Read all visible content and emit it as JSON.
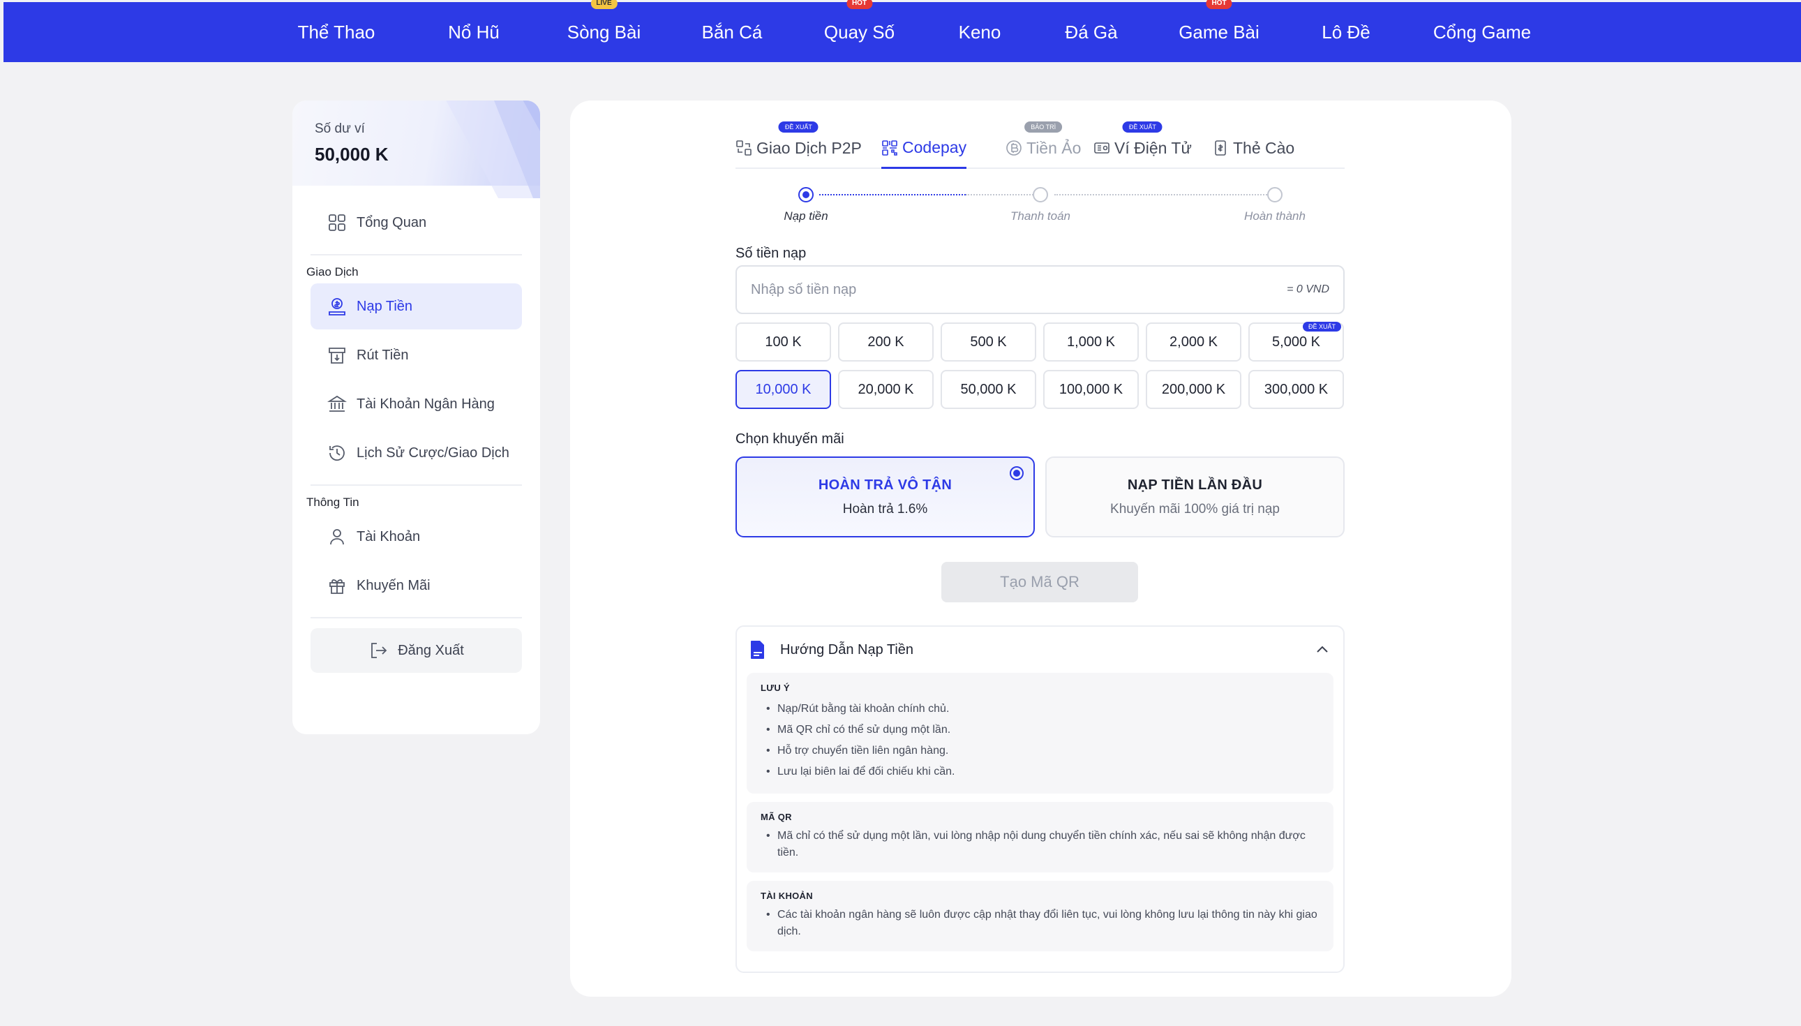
{
  "topnav": {
    "items": [
      {
        "label": "Thể Thao",
        "badge": ""
      },
      {
        "label": "Nổ Hũ",
        "badge": ""
      },
      {
        "label": "Sòng Bài",
        "badge": "LIVE"
      },
      {
        "label": "Bắn Cá",
        "badge": ""
      },
      {
        "label": "Quay Số",
        "badge": "HOT"
      },
      {
        "label": "Keno",
        "badge": ""
      },
      {
        "label": "Đá Gà",
        "badge": ""
      },
      {
        "label": "Game Bài",
        "badge": "HOT"
      },
      {
        "label": "Lô Đề",
        "badge": ""
      },
      {
        "label": "Cổng Game",
        "badge": ""
      }
    ]
  },
  "sidebar": {
    "wallet_label": "Số dư ví",
    "wallet_amount": "50,000 K",
    "overview": "Tổng Quan",
    "section_transactions": "Giao Dịch",
    "deposit": "Nạp Tiền",
    "withdraw": "Rút Tiền",
    "bank_account": "Tài Khoản Ngân Hàng",
    "history": "Lịch Sử Cược/Giao Dịch",
    "section_info": "Thông Tin",
    "account": "Tài Khoản",
    "promotions": "Khuyến Mãi",
    "logout": "Đăng Xuất"
  },
  "tabs": [
    {
      "label": "Giao Dịch P2P",
      "badge": "ĐỀ XUẤT",
      "state": "normal"
    },
    {
      "label": "Codepay",
      "badge": "",
      "state": "active"
    },
    {
      "label": "Tiền Ảo",
      "badge": "BẢO TRÌ",
      "state": "muted"
    },
    {
      "label": "Ví Điện Tử",
      "badge": "ĐỀ XUẤT",
      "state": "normal"
    },
    {
      "label": "Thẻ Cào",
      "badge": "",
      "state": "normal"
    }
  ],
  "steps": [
    "Nạp tiền",
    "Thanh toán",
    "Hoàn thành"
  ],
  "deposit_form": {
    "amount_label": "Số tiền nạp",
    "amount_placeholder": "Nhập số tiền nạp",
    "amount_value": "",
    "amount_suffix": "= 0 VND",
    "chips": [
      "100 K",
      "200 K",
      "500 K",
      "1,000 K",
      "2,000 K",
      "5,000 K",
      "10,000 K",
      "20,000 K",
      "50,000 K",
      "100,000 K",
      "200,000 K",
      "300,000 K"
    ],
    "chip_badge": "ĐỀ XUẤT",
    "selected_chip": "10,000 K",
    "promo_label": "Chọn khuyến mãi",
    "promos": [
      {
        "title": "HOÀN TRẢ VÔ TẬN",
        "sub": "Hoàn trả 1.6%"
      },
      {
        "title": "NẠP TIỀN LẦN ĐẦU",
        "sub": "Khuyến mãi 100% giá trị nạp"
      }
    ],
    "qr_button": "Tạo Mã QR"
  },
  "guide": {
    "title": "Hướng Dẫn Nạp Tiền",
    "blocks": [
      {
        "heading": "LƯU Ý",
        "items": [
          "Nạp/Rút bằng tài khoản chính chủ.",
          "Mã QR chỉ có thể sử dụng một lần.",
          "Hỗ trợ chuyển tiền liên ngân hàng.",
          "Lưu lại biên lai để đối chiếu khi cần."
        ]
      },
      {
        "heading": "MÃ QR",
        "items": [
          "Mã chỉ có thể sử dụng một lần, vui lòng nhập nội dung chuyển tiền chính xác, nếu sai sẽ không nhận được tiền."
        ]
      },
      {
        "heading": "TÀI KHOẢN",
        "items": [
          "Các tài khoản ngân hàng sẽ luôn được cập nhật thay đổi liên tục, vui lòng không lưu lại thông tin này khi giao dịch."
        ]
      }
    ]
  },
  "colors": {
    "accent": "#2d3ae6",
    "live_badge": "#f4c542",
    "hot_badge": "#e53935",
    "maintenance_badge": "#9aa0ad"
  },
  "icons": {
    "tabs": [
      "p2p-transfer-icon",
      "qr-code-icon",
      "crypto-coin-icon",
      "e-wallet-icon",
      "scratch-card-icon"
    ],
    "sidebar": [
      "grid-icon",
      "deposit-icon",
      "withdraw-icon",
      "bank-icon",
      "history-icon",
      "user-icon",
      "gift-icon",
      "logout-icon"
    ],
    "guide": [
      "document-icon",
      "chevron-up-icon"
    ]
  }
}
